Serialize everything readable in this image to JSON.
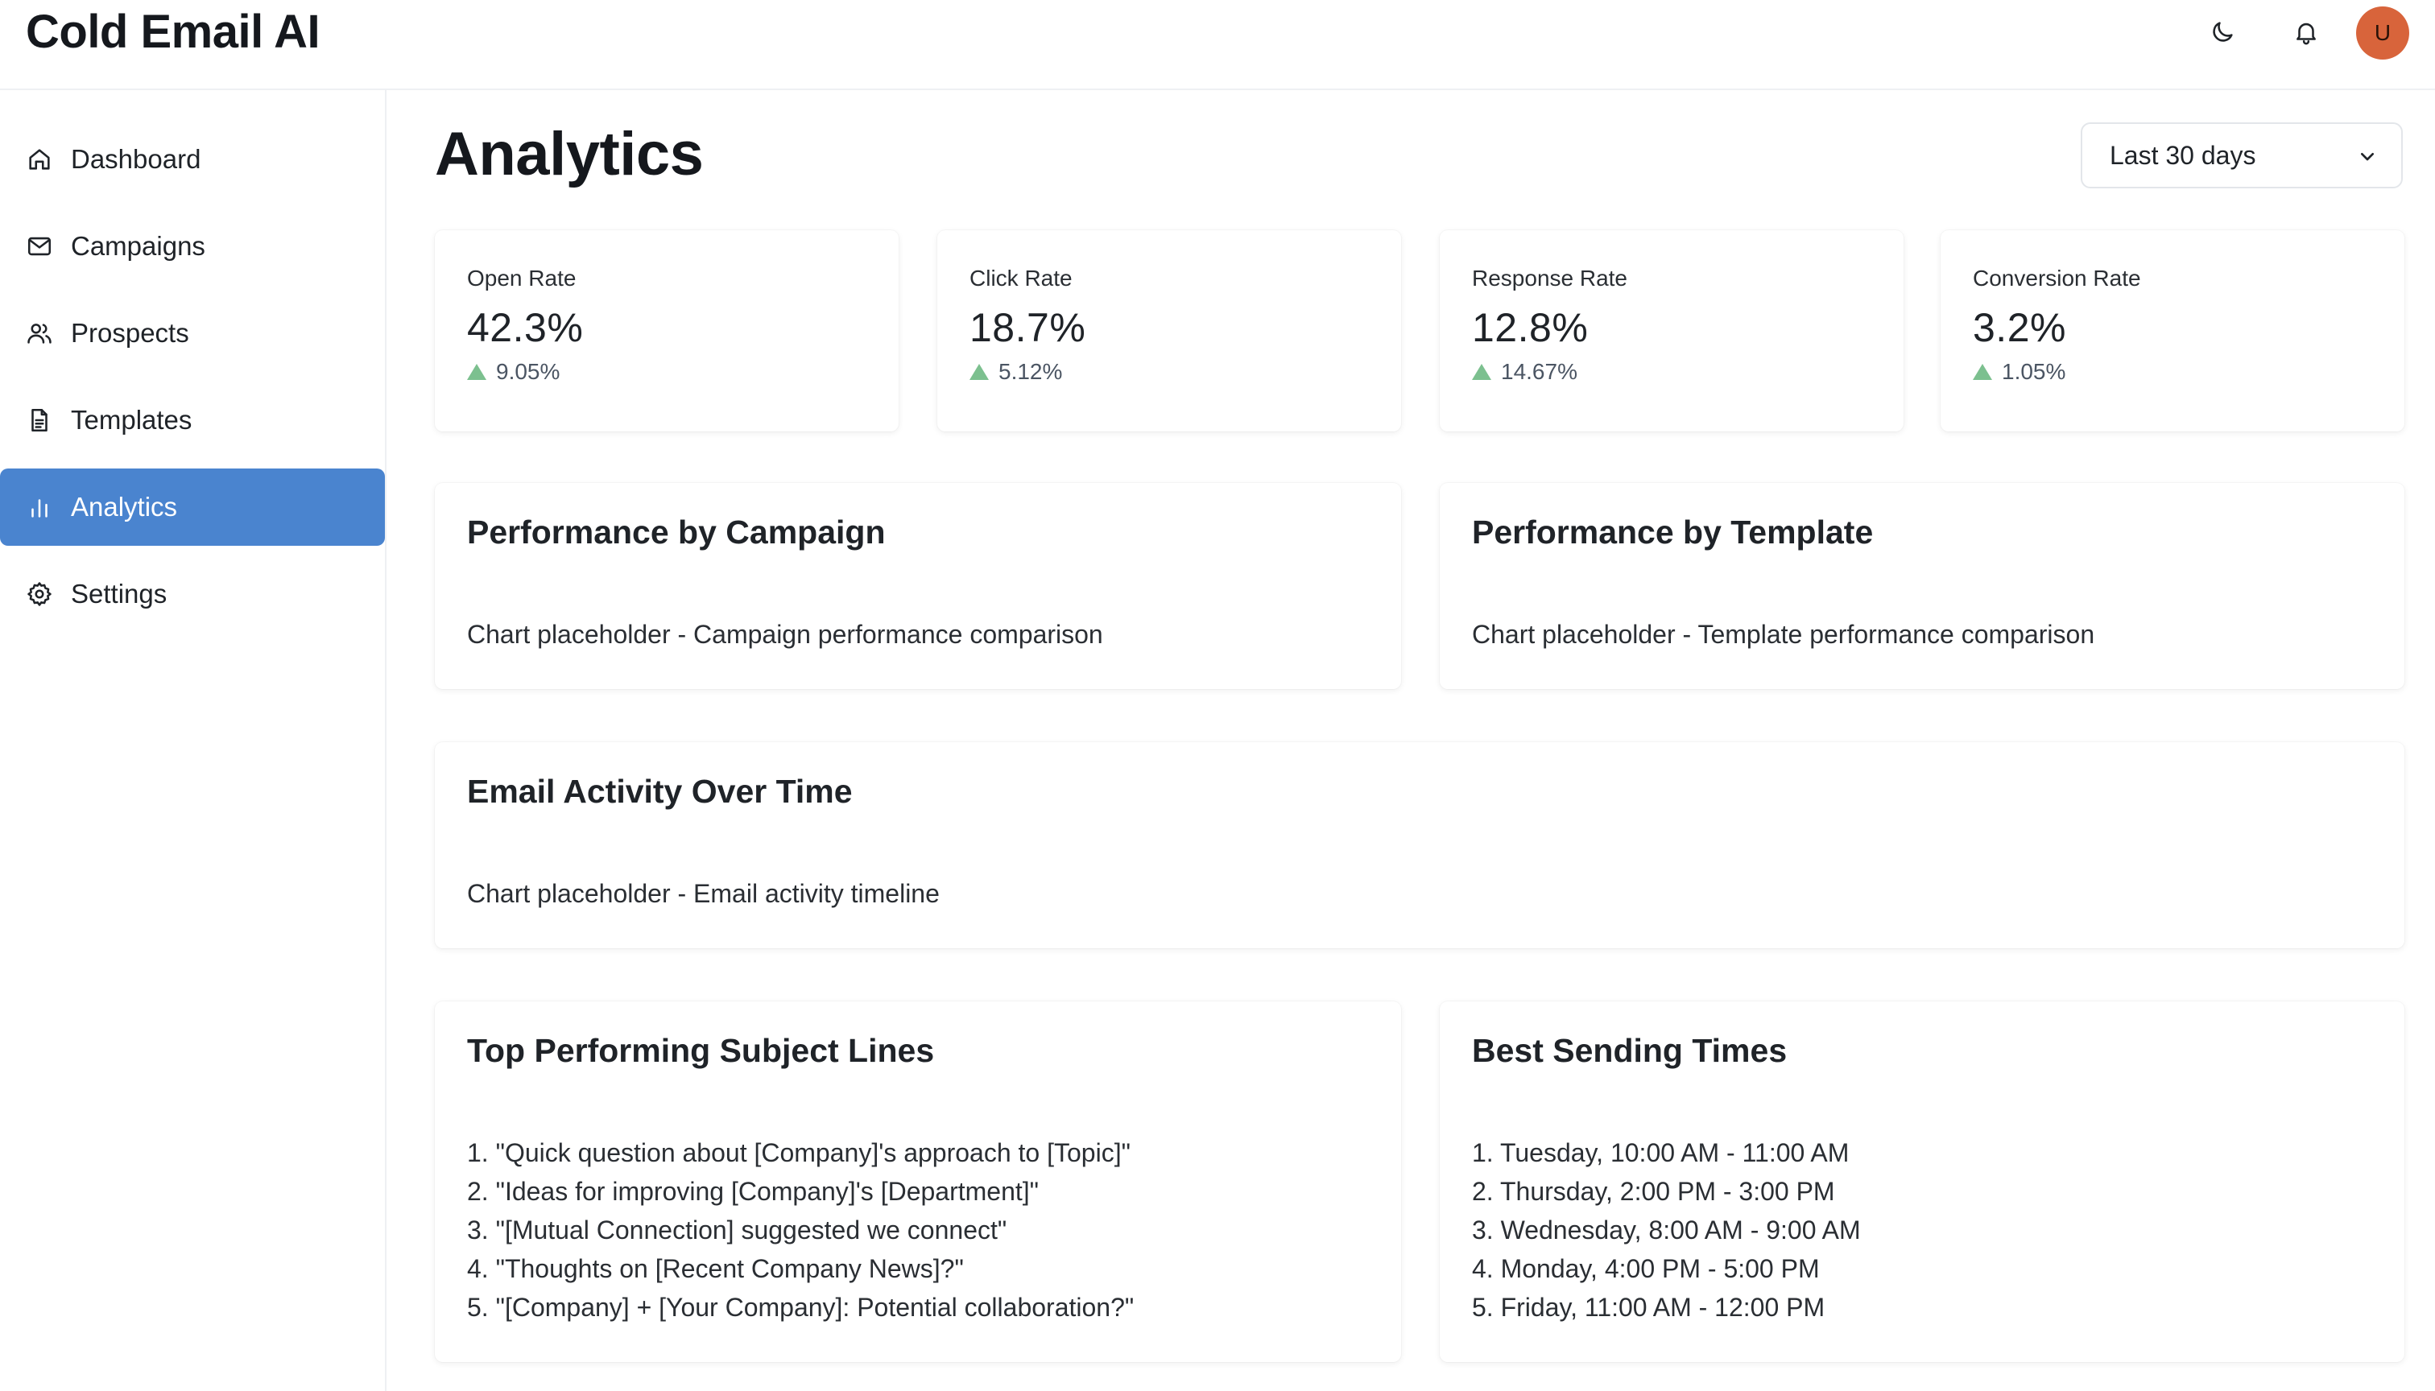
{
  "app": {
    "title": "Cold Email AI"
  },
  "header": {
    "icons": [
      "moon-icon",
      "bell-icon"
    ],
    "avatar_initial": "U",
    "avatar_color": "#d8643b"
  },
  "sidebar": {
    "active_color": "#4a84cf",
    "items": [
      {
        "label": "Dashboard",
        "icon": "home-icon",
        "active": false
      },
      {
        "label": "Campaigns",
        "icon": "mail-icon",
        "active": false
      },
      {
        "label": "Prospects",
        "icon": "users-icon",
        "active": false
      },
      {
        "label": "Templates",
        "icon": "document-icon",
        "active": false
      },
      {
        "label": "Analytics",
        "icon": "bar-chart-icon",
        "active": true
      },
      {
        "label": "Settings",
        "icon": "gear-icon",
        "active": false
      }
    ]
  },
  "main": {
    "title": "Analytics",
    "date_range": {
      "selected": "Last 30 days"
    },
    "stats": [
      {
        "label": "Open Rate",
        "value": "42.3%",
        "delta": "9.05%",
        "trend": "up"
      },
      {
        "label": "Click Rate",
        "value": "18.7%",
        "delta": "5.12%",
        "trend": "up"
      },
      {
        "label": "Response Rate",
        "value": "12.8%",
        "delta": "14.67%",
        "trend": "up"
      },
      {
        "label": "Conversion Rate",
        "value": "3.2%",
        "delta": "1.05%",
        "trend": "up"
      }
    ],
    "trend_up_color": "#7cc08f",
    "performance_by_campaign": {
      "title": "Performance by Campaign",
      "placeholder": "Chart placeholder - Campaign performance comparison"
    },
    "performance_by_template": {
      "title": "Performance by Template",
      "placeholder": "Chart placeholder - Template performance comparison"
    },
    "email_activity": {
      "title": "Email Activity Over Time",
      "placeholder": "Chart placeholder - Email activity timeline"
    },
    "top_subject_lines": {
      "title": "Top Performing Subject Lines",
      "items": [
        "1. \"Quick question about [Company]'s approach to [Topic]\"",
        "2. \"Ideas for improving [Company]'s [Department]\"",
        "3. \"[Mutual Connection] suggested we connect\"",
        "4. \"Thoughts on [Recent Company News]?\"",
        "5. \"[Company] + [Your Company]: Potential collaboration?\""
      ]
    },
    "best_sending_times": {
      "title": "Best Sending Times",
      "items": [
        "1. Tuesday, 10:00 AM - 11:00 AM",
        "2. Thursday, 2:00 PM - 3:00 PM",
        "3. Wednesday, 8:00 AM - 9:00 AM",
        "4. Monday, 4:00 PM - 5:00 PM",
        "5. Friday, 11:00 AM - 12:00 PM"
      ]
    }
  }
}
